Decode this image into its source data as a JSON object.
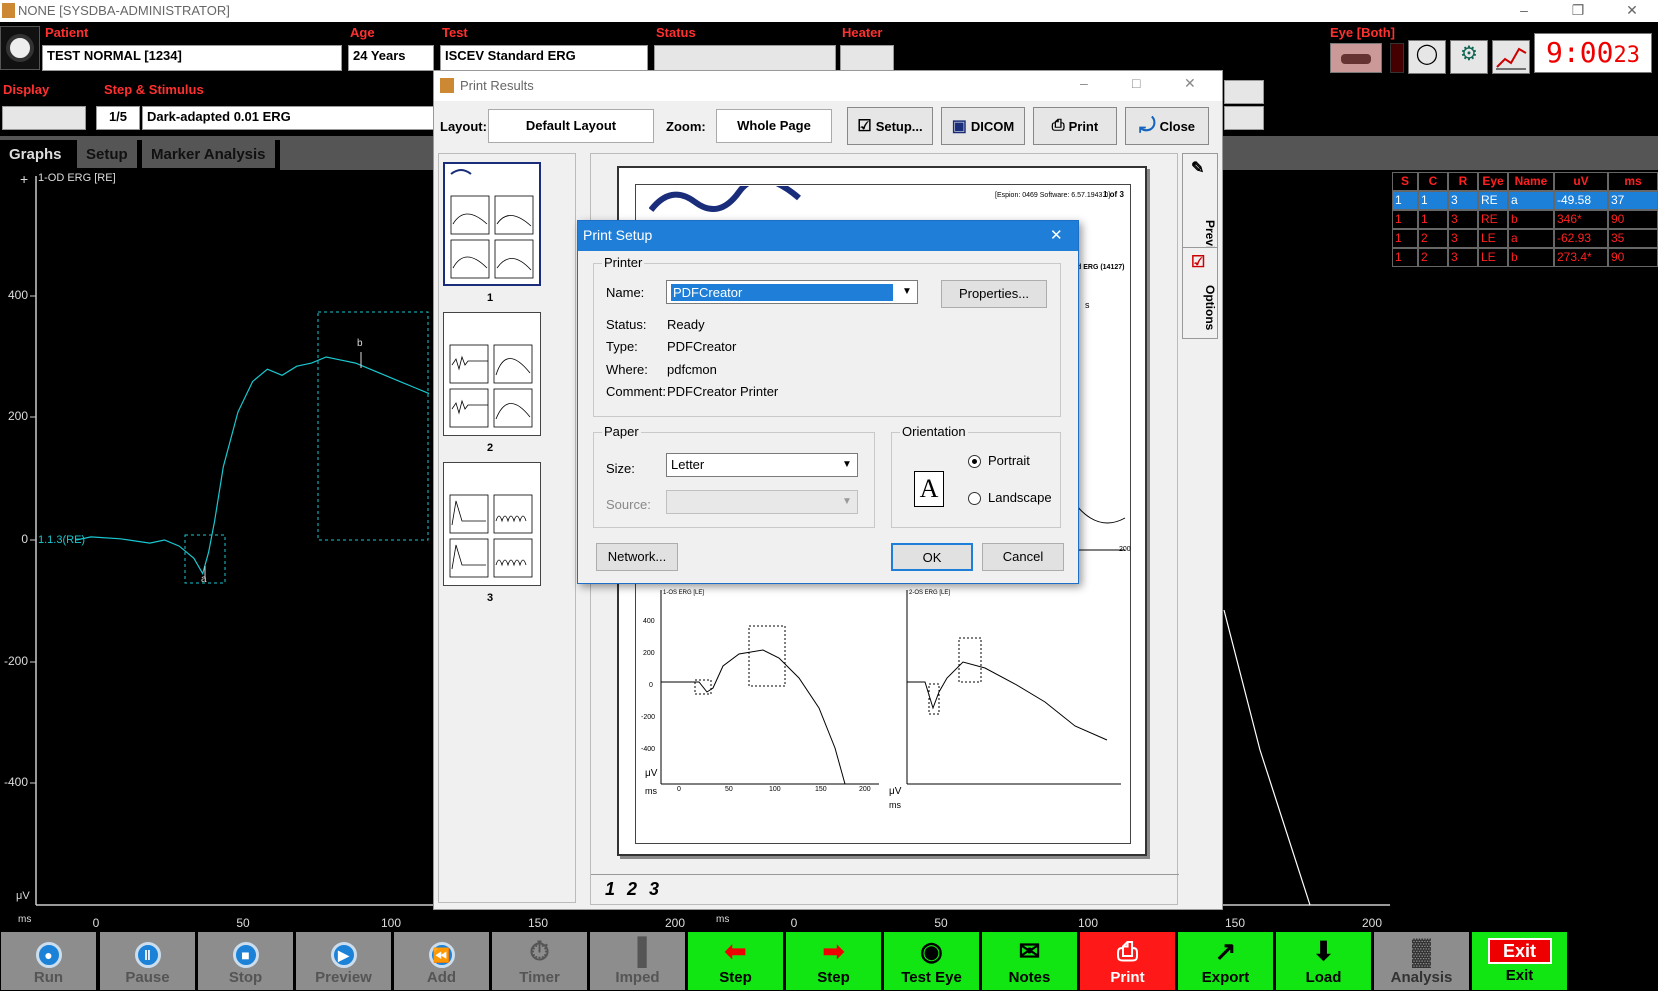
{
  "window": {
    "title": "NONE [SYSDBA-ADMINISTRATOR]"
  },
  "header": {
    "patient_label": "Patient",
    "patient": "TEST NORMAL [1234]",
    "age_label": "Age",
    "age": "24 Years",
    "test_label": "Test",
    "test": "ISCEV Standard ERG",
    "status_label": "Status",
    "heater_label": "Heater",
    "eye_label": "Eye [Both]",
    "clock": "9:00",
    "clock_sec": "23",
    "display_label": "Display",
    "step_label": "Step & Stimulus",
    "step": "1/5",
    "stimulus": "Dark-adapted 0.01 ERG"
  },
  "tabs": [
    "Graphs",
    "Setup",
    "Marker Analysis"
  ],
  "graph": {
    "channel": "1-OD ERG [RE]",
    "trace_label": "1.1.3(RE)",
    "marker_a": "a",
    "marker_b": "b",
    "y_unit": "μV",
    "x_unit": "ms",
    "y_ticks": [
      "400",
      "200",
      "0",
      "-200",
      "-400"
    ],
    "x_ticks": [
      "0",
      "50",
      "100",
      "150",
      "200"
    ],
    "x_ticks2": [
      "0",
      "50",
      "100",
      "150",
      "200"
    ],
    "x_unit2": "ms"
  },
  "chart_data": {
    "type": "line",
    "title": "1-OD ERG [RE]",
    "xlabel": "ms",
    "ylabel": "μV",
    "xlim": [
      -5,
      200
    ],
    "ylim": [
      -540,
      560
    ],
    "series": [
      {
        "name": "1.1.3(RE)",
        "x": [
          -5,
          0,
          10,
          20,
          25,
          30,
          35,
          38,
          40,
          42,
          45,
          50,
          55,
          60,
          65,
          70,
          75,
          80,
          85,
          90,
          95,
          100,
          105,
          110,
          115
        ],
        "y": [
          0,
          5,
          2,
          -5,
          0,
          -10,
          -30,
          -55,
          -20,
          30,
          120,
          210,
          260,
          280,
          270,
          285,
          290,
          300,
          295,
          290,
          280,
          270,
          260,
          250,
          240
        ]
      }
    ]
  },
  "results_table": {
    "headers": [
      "S",
      "C",
      "R",
      "Eye",
      "Name",
      "uV",
      "ms"
    ],
    "rows": [
      [
        "1",
        "1",
        "3",
        "RE",
        "a",
        "-49.58",
        "37"
      ],
      [
        "1",
        "1",
        "3",
        "RE",
        "b",
        "346*",
        "90"
      ],
      [
        "1",
        "2",
        "3",
        "LE",
        "a",
        "-62.93",
        "35"
      ],
      [
        "1",
        "2",
        "3",
        "LE",
        "b",
        "273.4*",
        "90"
      ]
    ]
  },
  "print_results": {
    "title": "Print Results",
    "layout_label": "Layout:",
    "layout": "Default Layout",
    "zoom_label": "Zoom:",
    "zoom": "Whole Page",
    "setup": "Setup...",
    "dicom": "DICOM",
    "print": "Print",
    "close": "Close",
    "pages": [
      "1",
      "2",
      "3"
    ],
    "page_tabs": [
      "1",
      "2",
      "3"
    ],
    "preview_tab": "Preview",
    "options_tab": "Options",
    "page_header": "[Espion: 0469 Software: 6.57.1943.0]",
    "page_of": "1 of 3",
    "page_erg": "d ERG (14127)",
    "page_s": "s",
    "page_channels": [
      "1-OS ERG [LE]",
      "2-OS ERG [LE]"
    ],
    "page_yticks": [
      "400",
      "200",
      "0",
      "-200",
      "-400"
    ],
    "page_xticks": [
      "0",
      "50",
      "100",
      "150",
      "200"
    ],
    "page_yunit": "μV",
    "page_xunit": "ms"
  },
  "print_setup": {
    "title": "Print Setup",
    "printer_group": "Printer",
    "name_label": "Name:",
    "name": "PDFCreator",
    "properties": "Properties...",
    "status_label": "Status:",
    "status": "Ready",
    "type_label": "Type:",
    "type": "PDFCreator",
    "where_label": "Where:",
    "where": "pdfcmon",
    "comment_label": "Comment:",
    "comment": "PDFCreator Printer",
    "paper_group": "Paper",
    "size_label": "Size:",
    "size": "Letter",
    "source_label": "Source:",
    "orientation_group": "Orientation",
    "portrait": "Portrait",
    "landscape": "Landscape",
    "orientation_selected": "Portrait",
    "network": "Network...",
    "ok": "OK",
    "cancel": "Cancel"
  },
  "toolbar": [
    {
      "label": "Run",
      "icon": "run-icon"
    },
    {
      "label": "Pause",
      "icon": "pause-icon"
    },
    {
      "label": "Stop",
      "icon": "stop-icon"
    },
    {
      "label": "Preview",
      "icon": "preview-icon"
    },
    {
      "label": "Add",
      "icon": "add-icon"
    },
    {
      "label": "Timer",
      "icon": "timer-icon"
    },
    {
      "label": "Imped",
      "icon": "imped-icon"
    },
    {
      "label": "Step",
      "icon": "step-back-icon"
    },
    {
      "label": "Step",
      "icon": "step-forward-icon"
    },
    {
      "label": "Test Eye",
      "icon": "eye-icon"
    },
    {
      "label": "Notes",
      "icon": "notes-icon"
    },
    {
      "label": "Print",
      "icon": "print-icon"
    },
    {
      "label": "Export",
      "icon": "export-icon"
    },
    {
      "label": "Load",
      "icon": "load-icon"
    },
    {
      "label": "Analysis",
      "icon": "analysis-icon"
    },
    {
      "label": "Exit",
      "icon": "exit-icon",
      "icon_text": "Exit"
    }
  ],
  "colors": {
    "trace": "#19c8d0",
    "header_label": "#ff3030",
    "table_text": "#ff2020",
    "table_selected": "#1c7fd8",
    "toolbar_green": "#12e612",
    "toolbar_red": "#ff1818",
    "toolbar_gray": "#8d8d8d"
  }
}
